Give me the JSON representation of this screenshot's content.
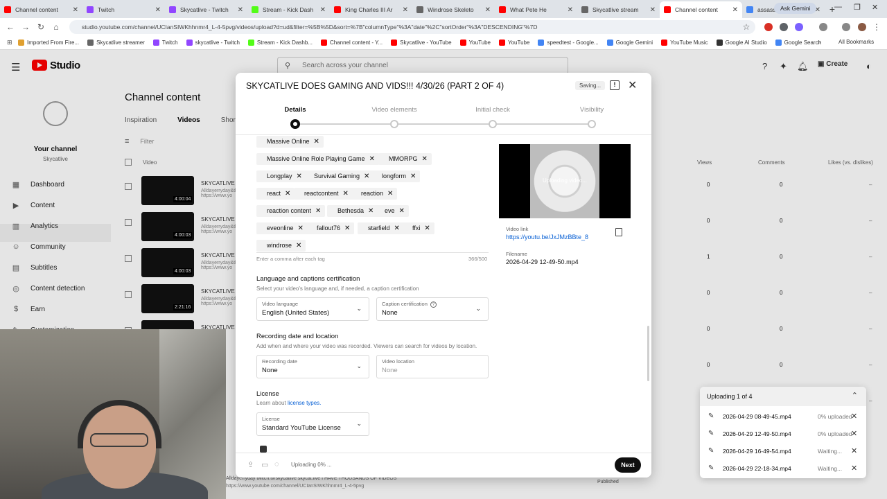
{
  "browser": {
    "tabs": [
      {
        "title": "Channel content",
        "color": "#ff0000"
      },
      {
        "title": "Twitch",
        "color": "#9146ff"
      },
      {
        "title": "Skycatlive - Twitch",
        "color": "#9146ff"
      },
      {
        "title": "Stream - Kick Dash",
        "color": "#53fc18"
      },
      {
        "title": "King Charles III Ar",
        "color": "#ff0000"
      },
      {
        "title": "Windrose Skeleto",
        "color": "#666666"
      },
      {
        "title": "What Pete He",
        "color": "#ff0000"
      },
      {
        "title": "Skycatlive stream",
        "color": "#666666"
      },
      {
        "title": "Channel content",
        "color": "#ff0000",
        "active": true
      },
      {
        "title": "assassins creed ar",
        "color": "#4285f4"
      }
    ],
    "ask_gemini": "Ask Gemini",
    "url": "studio.youtube.com/channel/UCIanSIWKhhnmr4_L-4-5pvg/videos/upload?d=ud&filter=%5B%5D&sort=%7B\"columnType\"%3A\"date\"%2C\"sortOrder\"%3A\"DESCENDING\"%7D",
    "bookmarks": [
      {
        "label": "Imported From Fire...",
        "color": "#e0a030"
      },
      {
        "label": "Skycatlive streamer",
        "color": "#666666"
      },
      {
        "label": "Twitch",
        "color": "#9146ff"
      },
      {
        "label": "skycatlive - Twitch",
        "color": "#9146ff"
      },
      {
        "label": "Stream - Kick Dashb...",
        "color": "#53fc18"
      },
      {
        "label": "Channel content - Y...",
        "color": "#ff0000"
      },
      {
        "label": "Skycatlive - YouTube",
        "color": "#ff0000"
      },
      {
        "label": "YouTube",
        "color": "#ff0000"
      },
      {
        "label": "YouTube",
        "color": "#ff0000"
      },
      {
        "label": "speedtest - Google...",
        "color": "#4285f4"
      },
      {
        "label": "Google Gemini",
        "color": "#4285f4"
      },
      {
        "label": "YouTube Music",
        "color": "#ff0000"
      },
      {
        "label": "Google AI Studio",
        "color": "#333333"
      },
      {
        "label": "Google Search",
        "color": "#4285f4"
      }
    ],
    "all_bookmarks": "All Bookmarks"
  },
  "studio": {
    "brand": "Studio",
    "search_placeholder": "Search across your channel",
    "create_label": "Create",
    "your_channel": "Your channel",
    "channel_name": "Skycatlive",
    "sidebar": [
      {
        "label": "Dashboard",
        "icon": "dashboard-icon"
      },
      {
        "label": "Content",
        "icon": "content-icon"
      },
      {
        "label": "Analytics",
        "icon": "analytics-icon"
      },
      {
        "label": "Community",
        "icon": "community-icon"
      },
      {
        "label": "Subtitles",
        "icon": "subtitles-icon"
      },
      {
        "label": "Content detection",
        "icon": "content-detection-icon"
      },
      {
        "label": "Earn",
        "icon": "earn-icon"
      },
      {
        "label": "Customization",
        "icon": "customization-icon"
      }
    ],
    "page_title": "Channel content",
    "tabs": [
      "Inspiration",
      "Videos",
      "Shorts"
    ],
    "filter_placeholder": "Filter",
    "columns": {
      "video": "Video",
      "views": "Views",
      "comments": "Comments",
      "likes": "Likes (vs. dislikes)"
    },
    "rows": [
      {
        "title": "SKYCATLIVE I",
        "desc": "Alldayerryday&this",
        "url": "https://www.yo",
        "duration": "4:00:04",
        "views": "0",
        "comments": "0",
        "likes": "–"
      },
      {
        "title": "SKYCATLIVE I",
        "desc": "Alldayerryday&this",
        "url": "https://www.yo",
        "duration": "4:00:03",
        "views": "0",
        "comments": "0",
        "likes": "–"
      },
      {
        "title": "SKYCATLIVE I",
        "desc": "Alldayerryday&this",
        "url": "https://www.yo",
        "duration": "4:00:03",
        "views": "1",
        "comments": "0",
        "likes": "–"
      },
      {
        "title": "SKYCATLIVE I",
        "desc": "Alldayerryday&this",
        "url": "https://www.yo",
        "duration": "2:21:16",
        "views": "0",
        "comments": "0",
        "likes": "–"
      },
      {
        "title": "SKYCATLIVE I",
        "desc": "",
        "url": "",
        "duration": "",
        "views": "0",
        "comments": "0",
        "likes": "–"
      },
      {
        "title": "",
        "desc": "",
        "url": "",
        "duration": "",
        "views": "0",
        "comments": "0",
        "likes": "–"
      },
      {
        "title": "",
        "desc": "",
        "url": "",
        "duration": "",
        "views": "0",
        "comments": "0",
        "likes": "–"
      }
    ],
    "bottom_desc": "Alldayerryday twitch.tv/skycatlive skycat.live I HAVE THOUSANDS OF VIDEOS",
    "bottom_url": "https://www.youtube.com/channel/UCIanSIWKhhnmr4_L-4-5pvg",
    "bottom_status": "Published"
  },
  "dialog": {
    "title": "SKYCATLIVE DOES GAMING AND VIDS!!! 4/30/26 (PART 2 OF 4)",
    "saving": "Saving...",
    "steps": [
      "Details",
      "Video elements",
      "Initial check",
      "Visibility"
    ],
    "tags": [
      "Massive Online",
      "Massive Online Role Playing Game",
      "MMORPG",
      "Longplay",
      "Survival Gaming",
      "longform",
      "react",
      "reactcontent",
      "reaction",
      "reaction content",
      "Bethesda",
      "eve",
      "eveonline",
      "fallout76",
      "starfield",
      "ffxi",
      "windrose"
    ],
    "tags_hint": "Enter a comma after each tag",
    "tags_count": "366/500",
    "language_section": {
      "title": "Language and captions certification",
      "subtitle": "Select your video's language and, if needed, a caption certification",
      "language_label": "Video language",
      "language_value": "English (United States)",
      "caption_label": "Caption certification",
      "caption_value": "None"
    },
    "recording_section": {
      "title": "Recording date and location",
      "subtitle": "Add when and where your video was recorded. Viewers can search for videos by location.",
      "date_label": "Recording date",
      "date_value": "None",
      "location_label": "Video location",
      "location_placeholder": "None"
    },
    "license_section": {
      "title": "License",
      "subtitle_prefix": "Learn about ",
      "subtitle_link": "license types.",
      "license_label": "License",
      "license_value": "Standard YouTube License"
    },
    "preview": {
      "status": "Uploading video...",
      "link_label": "Video link",
      "link": "https://youtu.be/JxJMzBBte_8",
      "filename_label": "Filename",
      "filename": "2026-04-29 12-49-50.mp4"
    },
    "footer_status": "Uploading 0% ...",
    "next_label": "Next"
  },
  "upload_panel": {
    "title": "Uploading 1 of 4",
    "items": [
      {
        "file": "2026-04-29 08-49-45.mp4",
        "status": "0% uploaded"
      },
      {
        "file": "2026-04-29 12-49-50.mp4",
        "status": "0% uploaded"
      },
      {
        "file": "2026-04-29 16-49-54.mp4",
        "status": "Waiting..."
      },
      {
        "file": "2026-04-29 22-18-34.mp4",
        "status": "Waiting..."
      }
    ]
  }
}
